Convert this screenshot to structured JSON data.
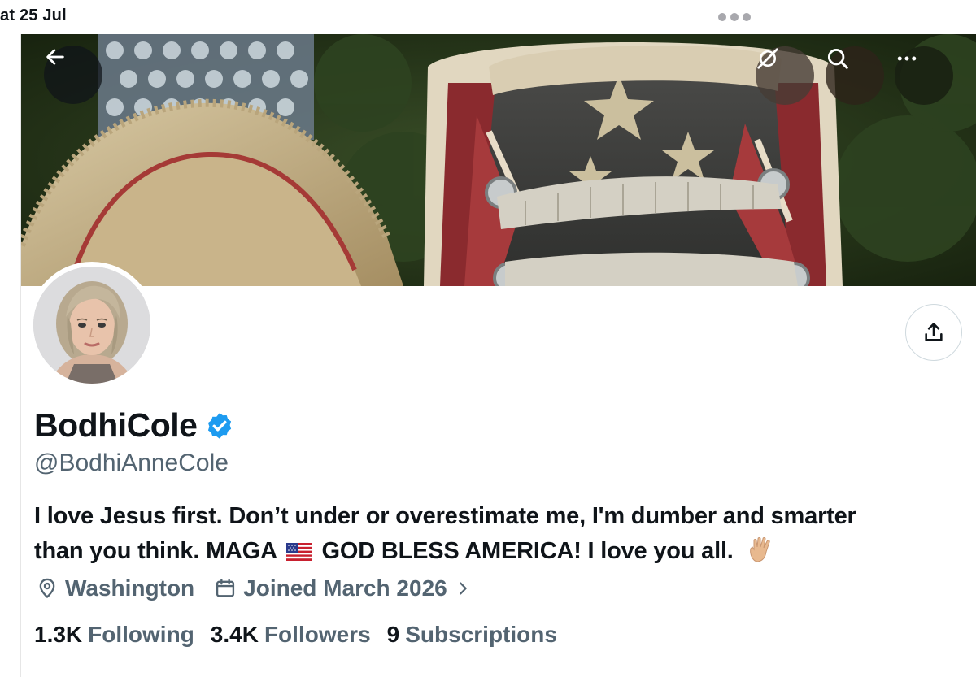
{
  "status_bar": {
    "time": "at 25 Jul"
  },
  "banner": {
    "back_icon": "arrow-left-icon",
    "grok_icon": "grok-icon",
    "search_icon": "search-icon",
    "more_icon": "more-horizontal-icon"
  },
  "profile": {
    "display_name": "BodhiCole",
    "verified": true,
    "handle": "@BodhiAnneCole",
    "bio_line1": "I love Jesus first. Don’t under or overestimate me, I'm dumber and smarter",
    "bio_line2_a": "than you think. MAGA",
    "bio_flag": "🇺🇸",
    "bio_line2_b": "GOD BLESS AMERICA! I love you all.",
    "bio_hand": "🖖🏼",
    "location": "Washington",
    "joined": "Joined March 2026",
    "stats": {
      "following_count": "1.3K",
      "following_label": "Following",
      "followers_count": "3.4K",
      "followers_label": "Followers",
      "subscriptions_count": "9",
      "subscriptions_label": "Subscriptions"
    }
  },
  "colors": {
    "text_primary": "#0f1419",
    "text_secondary": "#536471",
    "verified_blue": "#1d9bf0",
    "border": "#cfd9de"
  }
}
